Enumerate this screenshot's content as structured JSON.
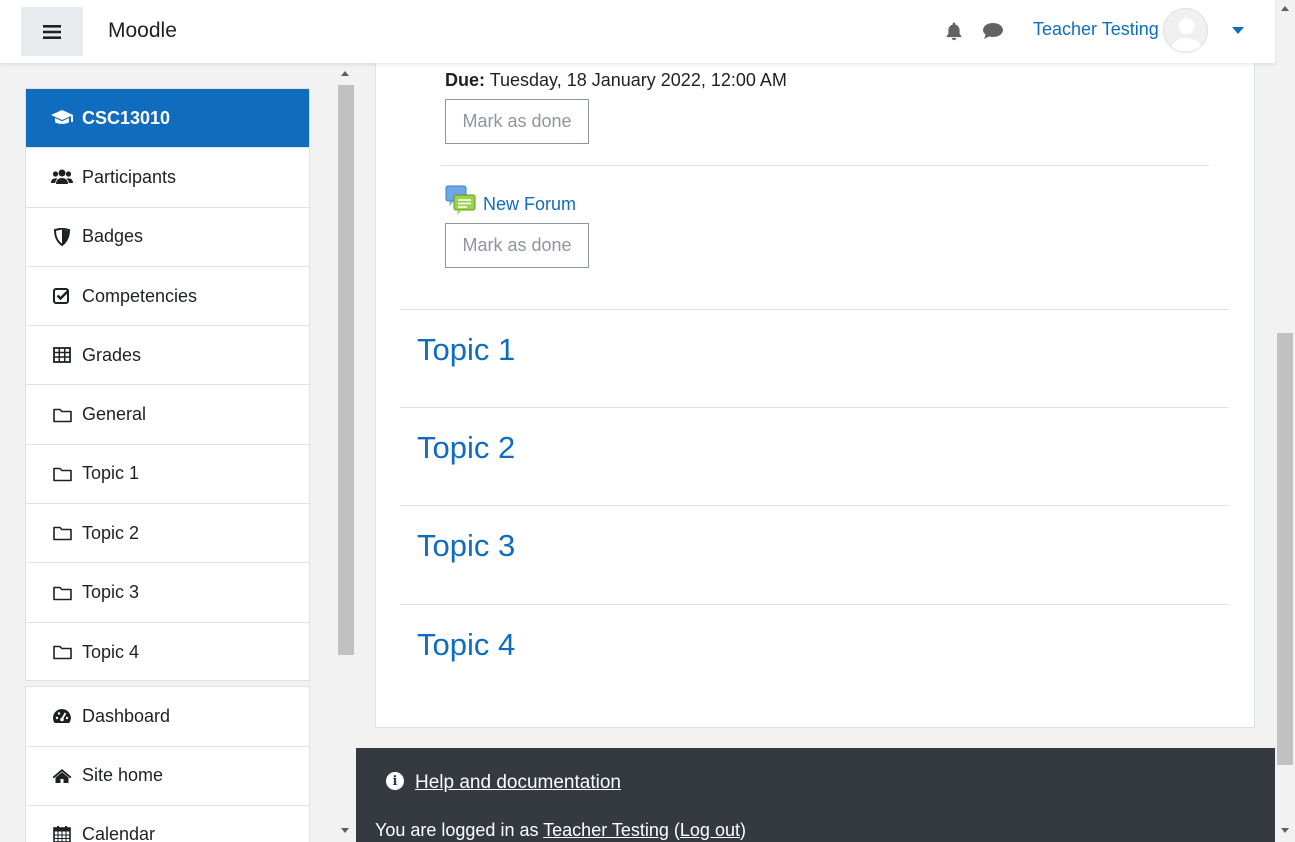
{
  "header": {
    "brand": "Moodle",
    "user_name": "Teacher Testing"
  },
  "drawer": {
    "course": "CSC13010",
    "nav_items": [
      {
        "label": "Participants",
        "icon": "users-icon"
      },
      {
        "label": "Badges",
        "icon": "shield-icon"
      },
      {
        "label": "Competencies",
        "icon": "check-square-icon"
      },
      {
        "label": "Grades",
        "icon": "table-icon"
      },
      {
        "label": "General",
        "icon": "folder-icon"
      },
      {
        "label": "Topic 1",
        "icon": "folder-icon"
      },
      {
        "label": "Topic 2",
        "icon": "folder-icon"
      },
      {
        "label": "Topic 3",
        "icon": "folder-icon"
      },
      {
        "label": "Topic 4",
        "icon": "folder-icon"
      }
    ],
    "site_items": [
      {
        "label": "Dashboard",
        "icon": "dashboard-icon"
      },
      {
        "label": "Site home",
        "icon": "home-icon"
      },
      {
        "label": "Calendar",
        "icon": "calendar-icon"
      }
    ]
  },
  "main": {
    "due_label": "Due:",
    "due_value": "Tuesday, 18 January 2022, 12:00 AM",
    "mark_done": "Mark as done",
    "forum_link": "New Forum",
    "topics": [
      "Topic 1",
      "Topic 2",
      "Topic 3",
      "Topic 4"
    ]
  },
  "footer": {
    "help": "Help and documentation",
    "logged_prefix": "You are logged in as",
    "logged_user": "Teacher Testing",
    "logout": "Log out"
  },
  "colors": {
    "primary": "#0f6cbf",
    "footer_bg": "#343a40"
  }
}
